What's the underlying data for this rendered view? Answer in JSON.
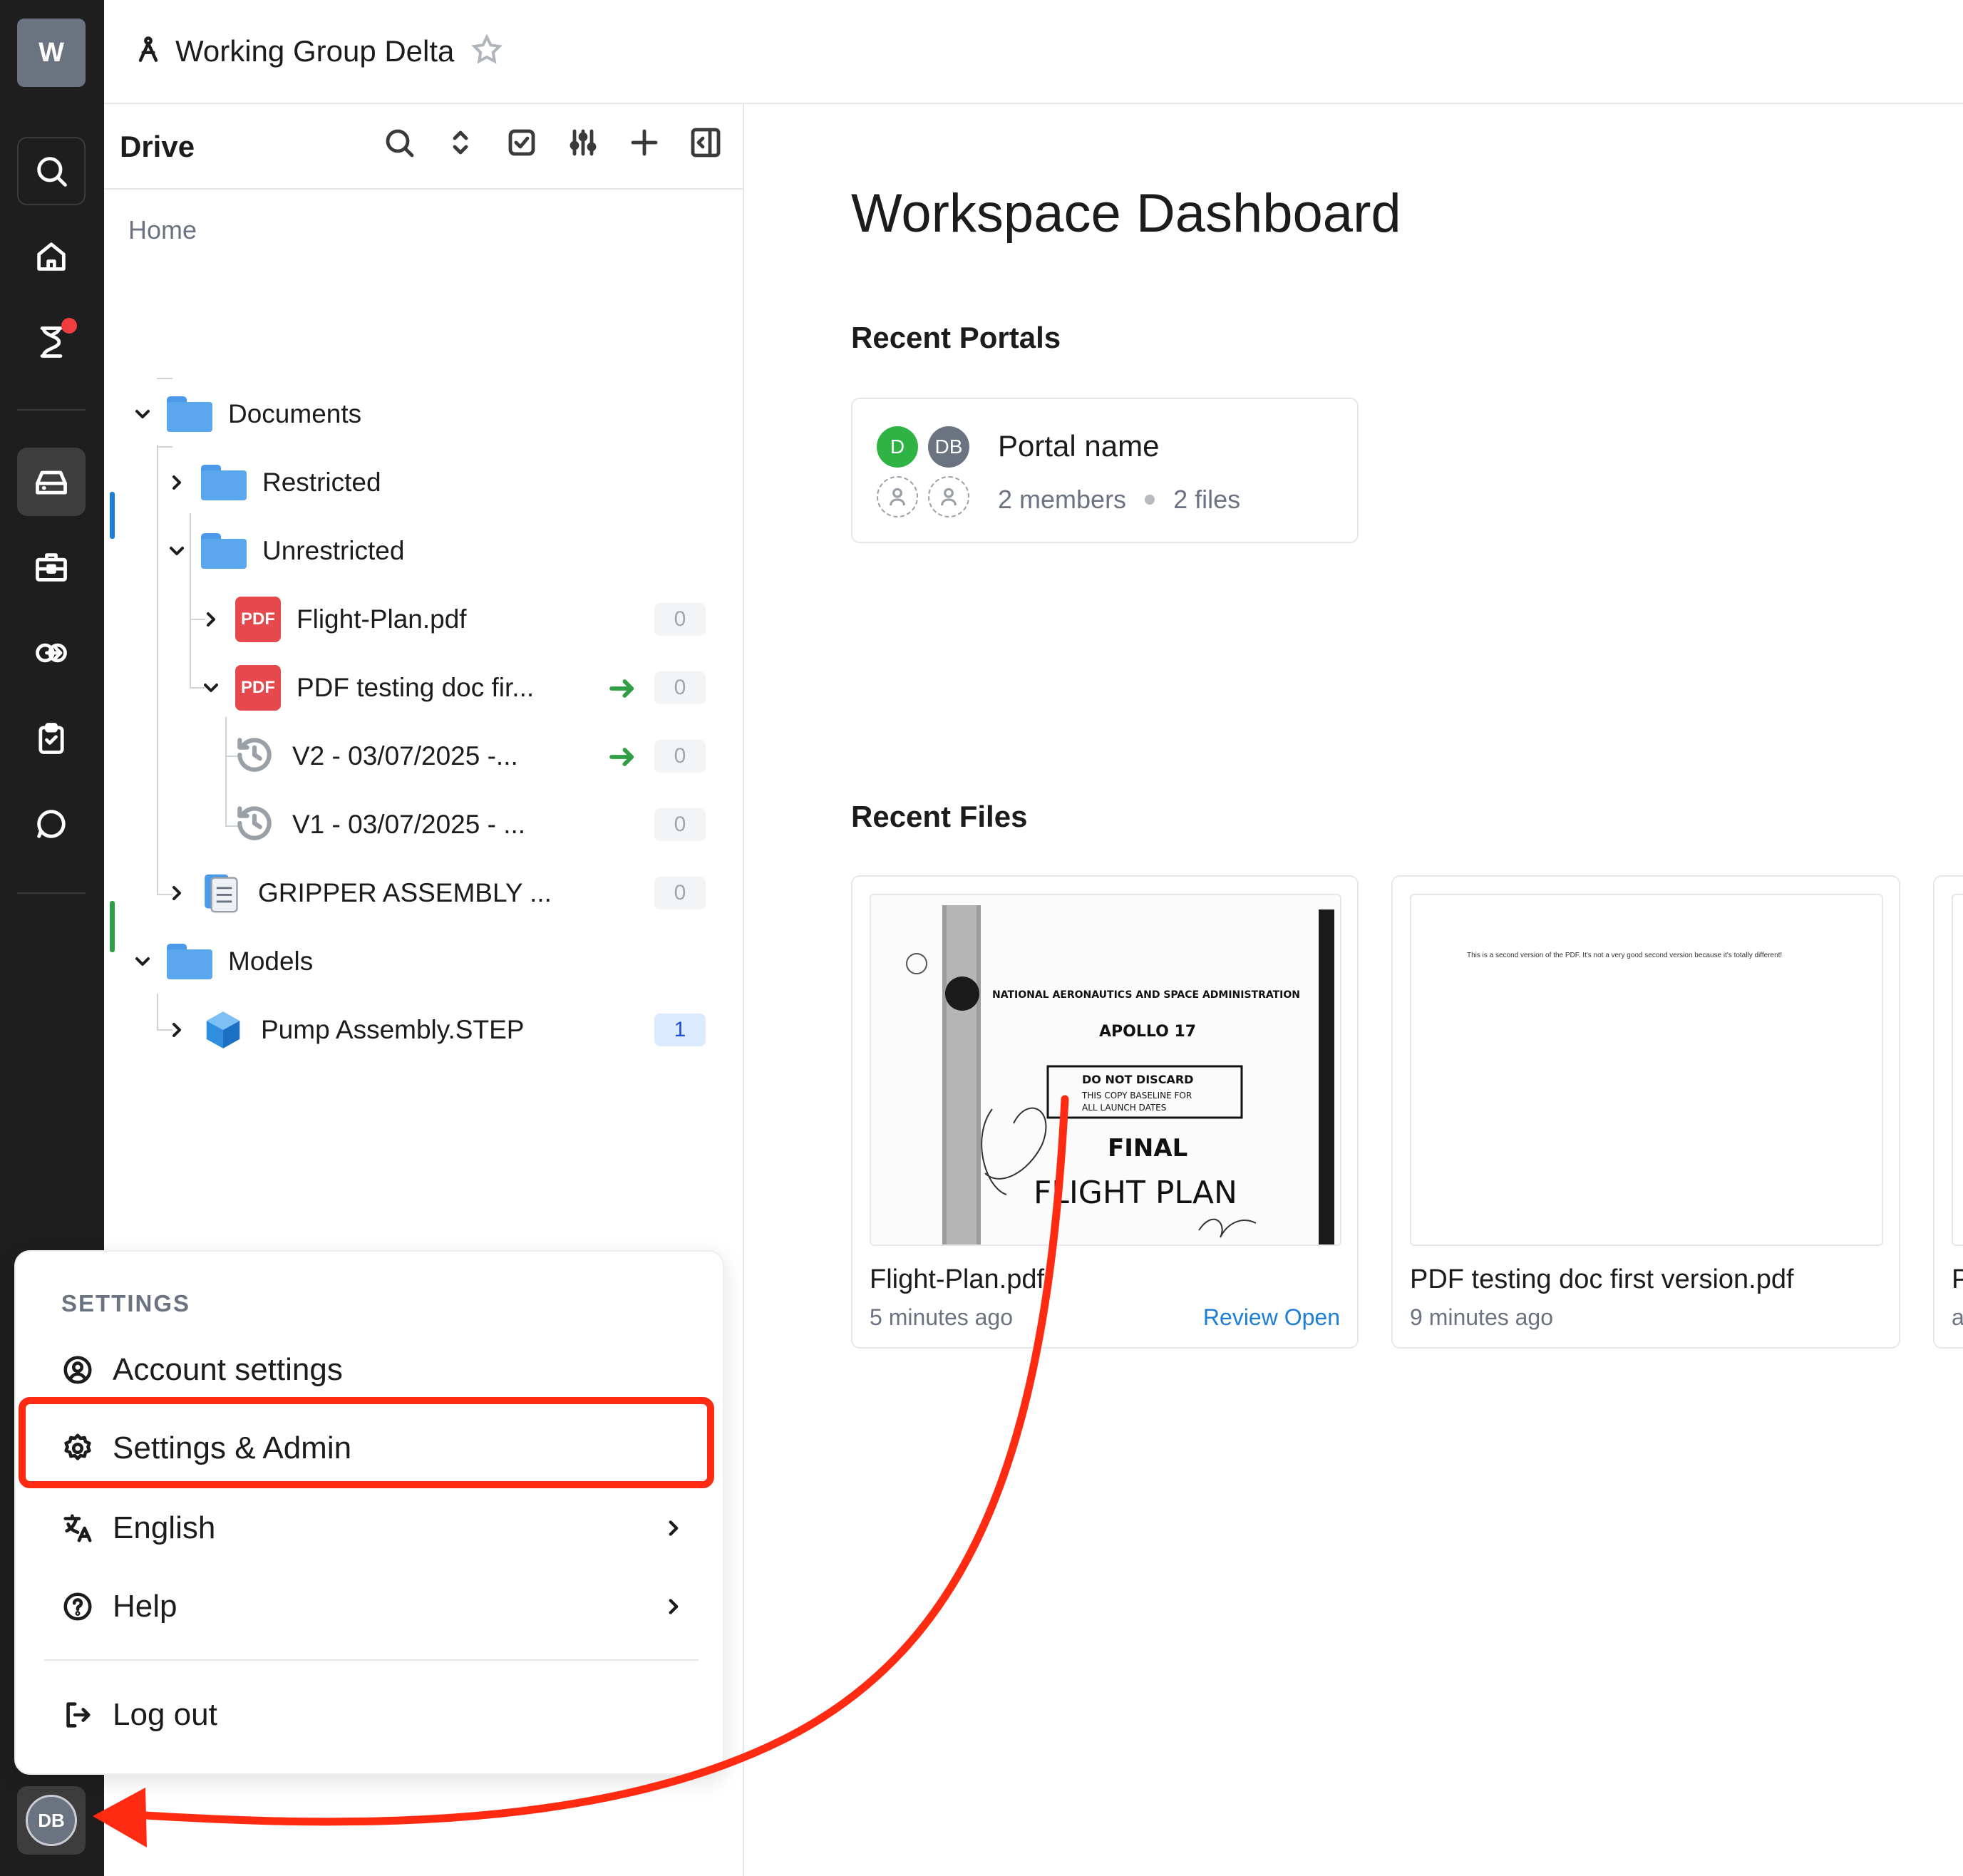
{
  "workspace": {
    "initial": "W",
    "name": "Working Group Delta"
  },
  "rail": {
    "items": [
      "search-icon",
      "home-icon",
      "hourglass-icon",
      "drive-icon",
      "briefcase-icon",
      "exchange-icon",
      "clipboard-check-icon",
      "chat-icon"
    ],
    "user_initials": "DB"
  },
  "drive": {
    "title": "Drive",
    "home": "Home",
    "tree": [
      {
        "label": "Documents",
        "type": "folder",
        "expanded": true
      },
      {
        "label": "Restricted",
        "type": "folder",
        "expanded": false
      },
      {
        "label": "Unrestricted",
        "type": "folder",
        "expanded": true
      },
      {
        "label": "Flight-Plan.pdf",
        "type": "pdf",
        "count": "0"
      },
      {
        "label": "PDF testing doc fir...",
        "type": "pdf",
        "count": "0"
      },
      {
        "label": "V2 - 03/07/2025 -...",
        "type": "version",
        "count": "0"
      },
      {
        "label": "V1 - 03/07/2025 - ...",
        "type": "version",
        "count": "0"
      },
      {
        "label": "GRIPPER ASSEMBLY ...",
        "type": "doc",
        "count": "0"
      },
      {
        "label": "Models",
        "type": "folder",
        "expanded": true
      },
      {
        "label": "Pump Assembly.STEP",
        "type": "step",
        "count": "1"
      }
    ],
    "pdf_badge": "PDF"
  },
  "main": {
    "title": "Workspace Dashboard",
    "recent_portals_title": "Recent Portals",
    "portal": {
      "name": "Portal name",
      "members": "2 members",
      "files": "2 files",
      "avatars": [
        {
          "initials": "D",
          "color": "#2fb344"
        },
        {
          "initials": "DB",
          "color": "#6b7280"
        }
      ]
    },
    "recent_files_title": "Recent Files",
    "files": [
      {
        "name": "Flight-Plan.pdf",
        "time": "5 minutes ago",
        "action": "Review Open",
        "thumb": {
          "agency": "NATIONAL AERONAUTICS AND SPACE ADMINISTRATION",
          "mission": "APOLLO 17",
          "stamp_title": "DO NOT DISCARD",
          "stamp_line1": "THIS COPY BASELINE FOR",
          "stamp_line2": "ALL LAUNCH DATES",
          "final": "FINAL",
          "plan": "FLIGHT PLAN"
        }
      },
      {
        "name": "PDF testing doc first version.pdf",
        "time": "9 minutes ago",
        "thumb_text": "This is a second version of the PDF. It's not a very good second version because it's totally different!"
      },
      {
        "name": "P",
        "time": "a"
      }
    ]
  },
  "menu": {
    "heading": "SETTINGS",
    "items": [
      {
        "label": "Account settings",
        "icon": "user-circle-icon"
      },
      {
        "label": "Settings & Admin",
        "icon": "gear-icon"
      },
      {
        "label": "English",
        "icon": "translate-icon",
        "submenu": true
      },
      {
        "label": "Help",
        "icon": "help-icon",
        "submenu": true
      },
      {
        "label": "Log out",
        "icon": "logout-icon"
      }
    ]
  },
  "annotation_color": "#ff2a12"
}
